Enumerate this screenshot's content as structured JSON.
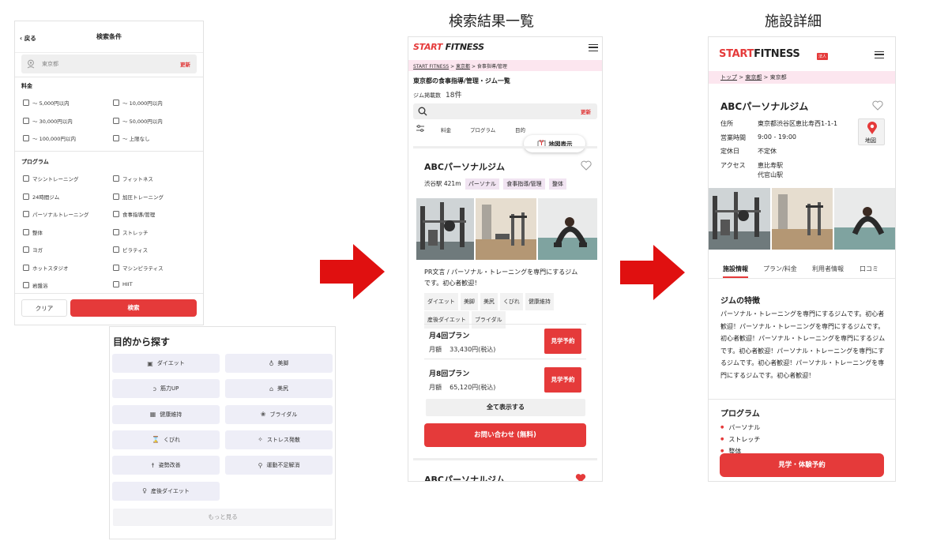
{
  "steps": {
    "results_title": "検索結果一覧",
    "detail_title": "施設詳細"
  },
  "search_conditions": {
    "back_label": "戻る",
    "title": "検索条件",
    "area_value": "東京都",
    "update_label": "更新",
    "price_section": "料金",
    "price_options": [
      "～ 5,000円以内",
      "～ 10,000円以内",
      "～ 30,000円以内",
      "～ 50,000円以内",
      "～ 100,000円以内",
      "～ 上限なし"
    ],
    "program_section": "プログラム",
    "program_options": [
      "マシントレーニング",
      "フィットネス",
      "24時間ジム",
      "加圧トレーニング",
      "パーソナルトレーニング",
      "食事指導/管理",
      "整体",
      "ストレッチ",
      "ヨガ",
      "ピラティス",
      "ホットスタジオ",
      "マシンピラティス",
      "岩盤浴",
      "HIIT"
    ],
    "clear_label": "クリア",
    "search_label": "検索"
  },
  "purpose": {
    "title": "目的から探す",
    "items": [
      {
        "label": "ダイエット",
        "icon": "scale-icon"
      },
      {
        "label": "美脚",
        "icon": "leg-icon"
      },
      {
        "label": "筋力UP",
        "icon": "muscle-icon"
      },
      {
        "label": "美尻",
        "icon": "hip-icon"
      },
      {
        "label": "健康維持",
        "icon": "calendar-heart-icon"
      },
      {
        "label": "ブライダル",
        "icon": "bouquet-icon"
      },
      {
        "label": "くびれ",
        "icon": "waist-icon"
      },
      {
        "label": "ストレス発散",
        "icon": "sparkle-icon"
      },
      {
        "label": "姿勢改善",
        "icon": "posture-icon"
      },
      {
        "label": "運動不足解消",
        "icon": "running-icon"
      },
      {
        "label": "産後ダイエット",
        "icon": "postpartum-icon"
      }
    ],
    "more_label": "もっと見る"
  },
  "results": {
    "logo_red": "START",
    "logo_dark": "FITNESS",
    "breadcrumb": [
      "START FITNESS",
      "東京都",
      "食事指導/管理"
    ],
    "page_title": "東京都の食事指導/管理・ジム一覧",
    "count_label": "ジム掲載数",
    "count_value": "18件",
    "update_label": "更新",
    "filters": [
      "料金",
      "プログラム",
      "目的"
    ],
    "map_label": "地図表示",
    "gym": {
      "name": "ABCパーソナルジム",
      "station": "渋谷駅 421m",
      "tags": [
        "パーソナル",
        "食事指導/管理",
        "整体"
      ],
      "pr": "PR文言 / パーソナル・トレーニングを専門にするジムです。初心者歓迎！",
      "keywords": [
        "ダイエット",
        "美脚",
        "美尻",
        "くびれ",
        "健康維持",
        "産後ダイエット",
        "ブライダル"
      ],
      "plans": [
        {
          "name": "月4回プラン",
          "price_label": "月額",
          "price": "33,430円(税込)",
          "button": "見学予約"
        },
        {
          "name": "月8回プラン",
          "price_label": "月額",
          "price": "65,120円(税込)",
          "button": "見学予約"
        }
      ],
      "show_all": "全て表示する",
      "inquiry": "お問い合わせ (無料)"
    },
    "next_gym_name": "ABCパーソナルジム"
  },
  "detail": {
    "logo_red": "START",
    "logo_dark": "FITNESS",
    "badge": "法人",
    "breadcrumb": [
      "トップ",
      "東京都",
      "東京都"
    ],
    "name": "ABCパーソナルジム",
    "info": [
      {
        "label": "住所",
        "value": "東京都渋谷区恵比寿西1-1-1"
      },
      {
        "label": "営業時間",
        "value": "9:00 - 19:00"
      },
      {
        "label": "定休日",
        "value": "不定休"
      },
      {
        "label": "アクセス",
        "value": "恵比寿駅"
      },
      {
        "label": "",
        "value": "代官山駅"
      }
    ],
    "map_label": "地図",
    "tabs": [
      "施設情報",
      "プラン/料金",
      "利用者情報",
      "口コミ"
    ],
    "feature_title": "ジムの特徴",
    "feature_text": "パーソナル・トレーニングを専門にするジムです。初心者歓迎！パーソナル・トレーニングを専門にするジムです。初心者歓迎！パーソナル・トレーニングを専門にするジムです。初心者歓迎！パーソナル・トレーニングを専門にするジムです。初心者歓迎！パーソナル・トレーニングを専門にするジムです。初心者歓迎！",
    "program_title": "プログラム",
    "programs": [
      "パーソナル",
      "ストレッチ",
      "整体"
    ],
    "cta": "見学・体験予約"
  },
  "colors": {
    "accent": "#e53a3a",
    "breadcrumb_bg": "#fce6ef",
    "tag_bg": "#f1e4f2",
    "purpose_bg": "#eeeef7"
  }
}
